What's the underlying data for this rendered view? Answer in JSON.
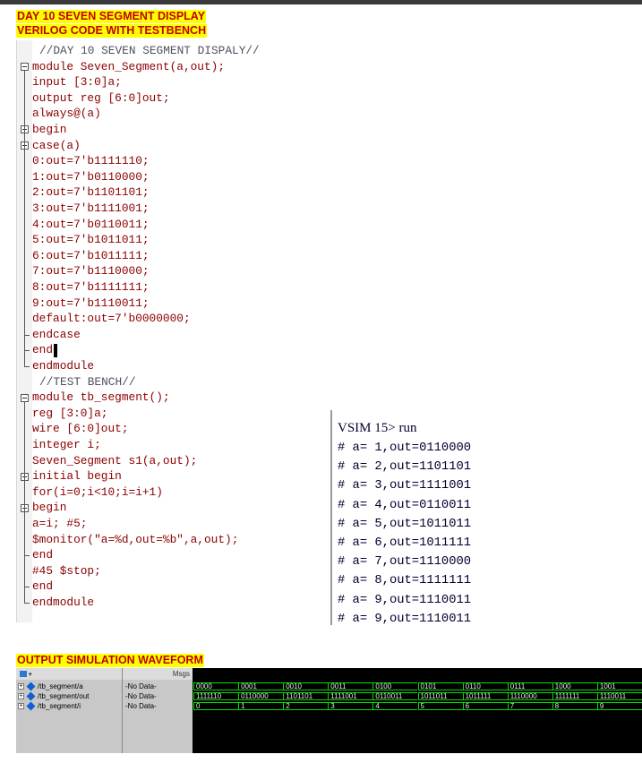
{
  "headings": {
    "title": "DAY 10  SEVEN SEGMENT DISPLAY",
    "subtitle": "VERILOG CODE WITH TESTBENCH",
    "waveform": "OUTPUT SIMULATION WAVEFORM"
  },
  "code": {
    "lines": [
      "//DAY 10 SEVEN SEGMENT DISPALY//",
      "module Seven_Segment(a,out);",
      "input [3:0]a;",
      "output reg [6:0]out;",
      "always@(a)",
      "begin",
      "case(a)",
      "0:out=7'b1111110;",
      "1:out=7'b0110000;",
      "2:out=7'b1101101;",
      "3:out=7'b1111001;",
      "4:out=7'b0110011;",
      "5:out=7'b1011011;",
      "6:out=7'b1011111;",
      "7:out=7'b1110000;",
      "8:out=7'b1111111;",
      "9:out=7'b1110011;",
      "default:out=7'b0000000;",
      "endcase",
      "end",
      "endmodule",
      "//TEST BENCH//",
      "module tb_segment();",
      "reg [3:0]a;",
      "wire [6:0]out;",
      "integer i;",
      "Seven_Segment s1(a,out);",
      "initial begin",
      "for(i=0;i<10;i=i+1)",
      "begin",
      "a=i; #5;",
      "$monitor(\"a=%d,out=%b\",a,out);",
      "end",
      "#45 $stop;",
      "end",
      "endmodule"
    ]
  },
  "console": {
    "partial": "·········  ·····",
    "prompt": "VSIM 15> run",
    "lines": [
      "# a= 1,out=0110000",
      "# a= 2,out=1101101",
      "# a= 3,out=1111001",
      "# a= 4,out=0110011",
      "# a= 5,out=1011011",
      "# a= 6,out=1011111",
      "# a= 7,out=1110000",
      "# a= 8,out=1111111",
      "# a= 9,out=1110011",
      "# a= 9,out=1110011"
    ]
  },
  "wave": {
    "msgs_header": "Msgs",
    "signals": [
      {
        "name": "/tb_segment/a",
        "msg": "-No Data-",
        "values": [
          "0000",
          "0001",
          "0010",
          "0011",
          "0100",
          "0101",
          "0110",
          "0111",
          "1000",
          "1001"
        ]
      },
      {
        "name": "/tb_segment/out",
        "msg": "-No Data-",
        "values": [
          "1111110",
          "0110000",
          "1101101",
          "1111001",
          "0110011",
          "1011011",
          "1011111",
          "1110000",
          "1111111",
          "1110011"
        ]
      },
      {
        "name": "/tb_segment/i",
        "msg": "-No Data-",
        "values": [
          "0",
          "1",
          "2",
          "3",
          "4",
          "5",
          "6",
          "7",
          "8",
          "9"
        ]
      }
    ]
  },
  "colors": {
    "highlight": "#ffff00",
    "heading_text": "#c00000",
    "wave_trace": "#00e000"
  }
}
